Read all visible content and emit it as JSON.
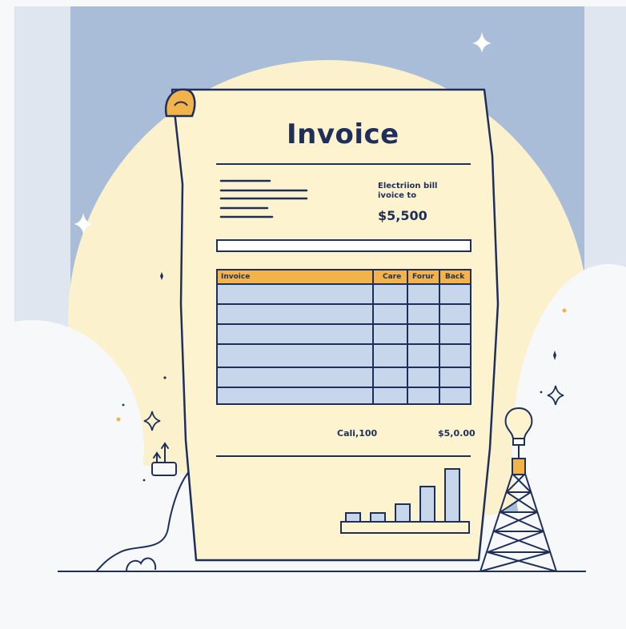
{
  "invoice": {
    "title": "Invoice",
    "bill_title": "Electriion bill",
    "bill_subtitle": "ivoice to",
    "amount": "$5,500",
    "table": {
      "headers": [
        "Invoice",
        "Care",
        "Forur",
        "Back"
      ],
      "row_count": 6
    },
    "summary": {
      "label": "Cali,100",
      "value": "$5,0.00"
    },
    "mini_bar_values": [
      1,
      1,
      2,
      4,
      6
    ]
  },
  "icons": [
    "sparkle-icon",
    "plug-icon",
    "light-bulb-icon",
    "power-tower-icon",
    "cloud-icon"
  ],
  "colors": {
    "sky": "#a9bdd9",
    "paper": "#fdf3cf",
    "sun": "#fbf1cc",
    "ink": "#1f2f5c",
    "accent": "#f2b44a",
    "table_fill": "#c8d6ec"
  }
}
